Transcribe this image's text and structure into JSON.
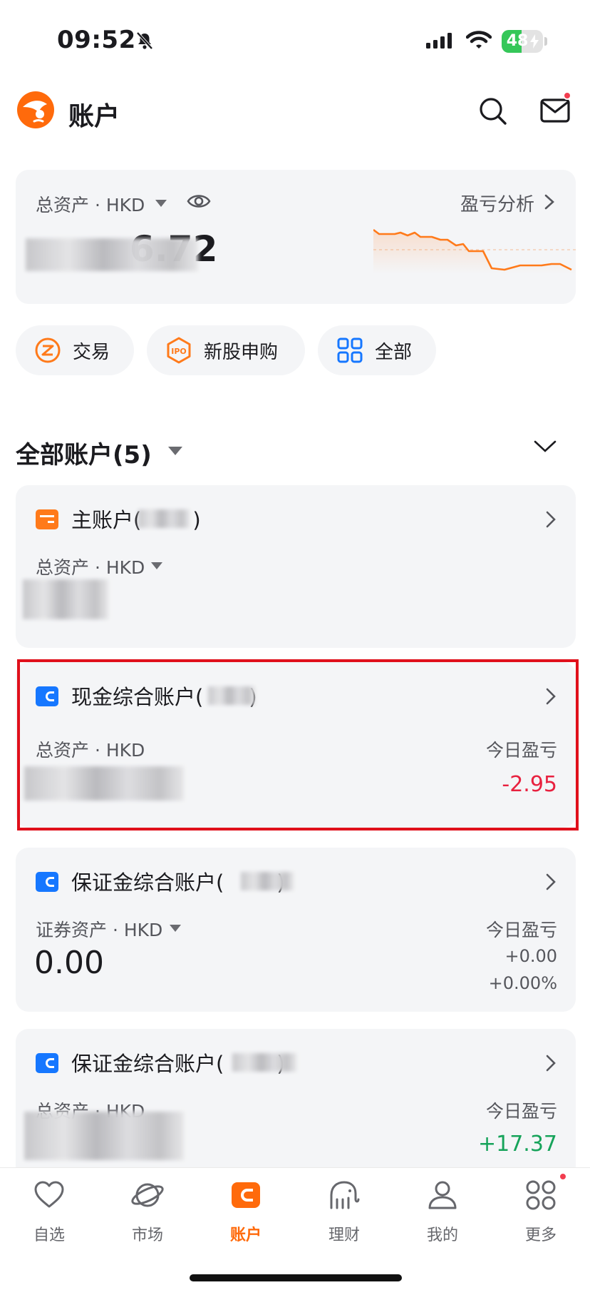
{
  "status_bar": {
    "time": "09:52",
    "battery": "48",
    "battery_level": 0.48
  },
  "header": {
    "title": "账户"
  },
  "summary": {
    "label": "总资产 · HKD",
    "pl_link": "盈亏分析",
    "value_visible_fragment": "6.72"
  },
  "quick_actions": [
    {
      "label": "交易",
      "icon": "trade-icon"
    },
    {
      "label": "新股申购",
      "icon": "ipo-icon"
    },
    {
      "label": "全部",
      "icon": "grid-icon"
    }
  ],
  "section": {
    "title": "全部账户(5)"
  },
  "accounts": [
    {
      "name": "主账户(",
      "name_suffix": ")",
      "icon_color": "#ff7a1a",
      "label": "总资产 · HKD"
    },
    {
      "name": "现金综合账户(",
      "name_suffix": ")",
      "icon_color": "#1677ff",
      "label": "总资产 · HKD",
      "pl_title": "今日盈亏",
      "pl_value": "-2.95"
    },
    {
      "name": "保证金综合账户(",
      "name_suffix": ")",
      "icon_color": "#1677ff",
      "label": "证券资产 · HKD",
      "value": "0.00",
      "pl_title": "今日盈亏",
      "pl_value": "+0.00",
      "pl_percent": "+0.00%"
    },
    {
      "name": "保证金综合账户(",
      "name_suffix": ")",
      "icon_color": "#1677ff",
      "label": "总资产 · HKD",
      "pl_title": "今日盈亏",
      "pl_value": "+17.37"
    }
  ],
  "colors": {
    "accent": "#ff6a0b",
    "loss": "#e8213f",
    "gain": "#16a35a",
    "highlight": "#e0101b"
  },
  "tabs": [
    {
      "label": "自选",
      "icon": "heart-icon"
    },
    {
      "label": "市场",
      "icon": "planet-icon"
    },
    {
      "label": "账户",
      "icon": "wallet-icon",
      "active": true
    },
    {
      "label": "理财",
      "icon": "elephant-icon"
    },
    {
      "label": "我的",
      "icon": "person-icon"
    },
    {
      "label": "更多",
      "icon": "more-icon"
    }
  ]
}
